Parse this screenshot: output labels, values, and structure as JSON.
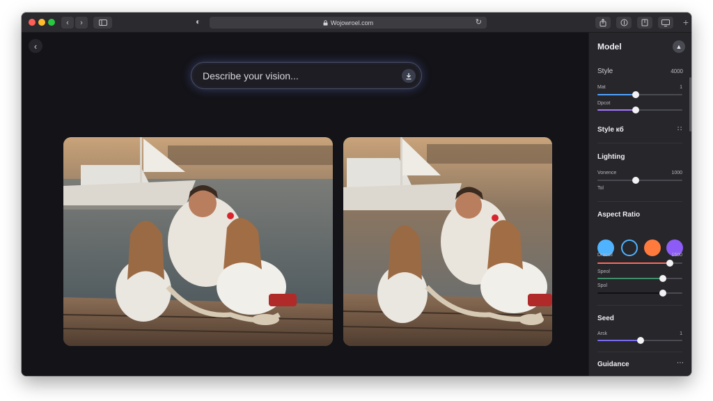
{
  "browser": {
    "address": "Wojowroel.com",
    "colors": {
      "close": "#ff5f57",
      "minimize": "#febc2e",
      "maximize": "#28c840"
    }
  },
  "main": {
    "prompt_placeholder": "Describe your vision..."
  },
  "panel": {
    "title": "Model",
    "style": {
      "label": "Style",
      "value": "4000"
    },
    "sliders_top": [
      {
        "label": "Mat",
        "value_text": "1",
        "level": 0.45,
        "color": "#4fa3ff"
      },
      {
        "label": "Dpcot",
        "value_text": "",
        "level": 0.45,
        "color": "#a678ff"
      }
    ],
    "style_section": {
      "label": "Style кб",
      "icon": "drag-dots-icon"
    },
    "lighting": {
      "title": "Lighting",
      "slider": {
        "label": "Vonence",
        "value_text": "1000",
        "level": 0.45,
        "color": "#4a4a52"
      },
      "sub_label": "Tol"
    },
    "aspect_ratio": {
      "title": "Aspect Ratio",
      "swatches": [
        "#4fb3ff",
        "transparent",
        "#ff7a3d",
        "#8d5cf6"
      ],
      "sliders": [
        {
          "label": "Dracull",
          "value_text": "1500",
          "level": 0.85,
          "color": "#ff6a5c"
        },
        {
          "label": "Speol",
          "value_text": "",
          "level": 0.77,
          "color": "#3f8f6a"
        },
        {
          "label": "Spol",
          "value_text": "",
          "level": 0.77,
          "color": "#111114"
        }
      ]
    },
    "seed": {
      "title": "Seed",
      "slider": {
        "label": "Arsk",
        "value_text": "1",
        "level": 0.51,
        "color": "#7a6cf0"
      }
    },
    "guidance": {
      "title": "Guidance",
      "icon": "more-dots-icon"
    }
  }
}
